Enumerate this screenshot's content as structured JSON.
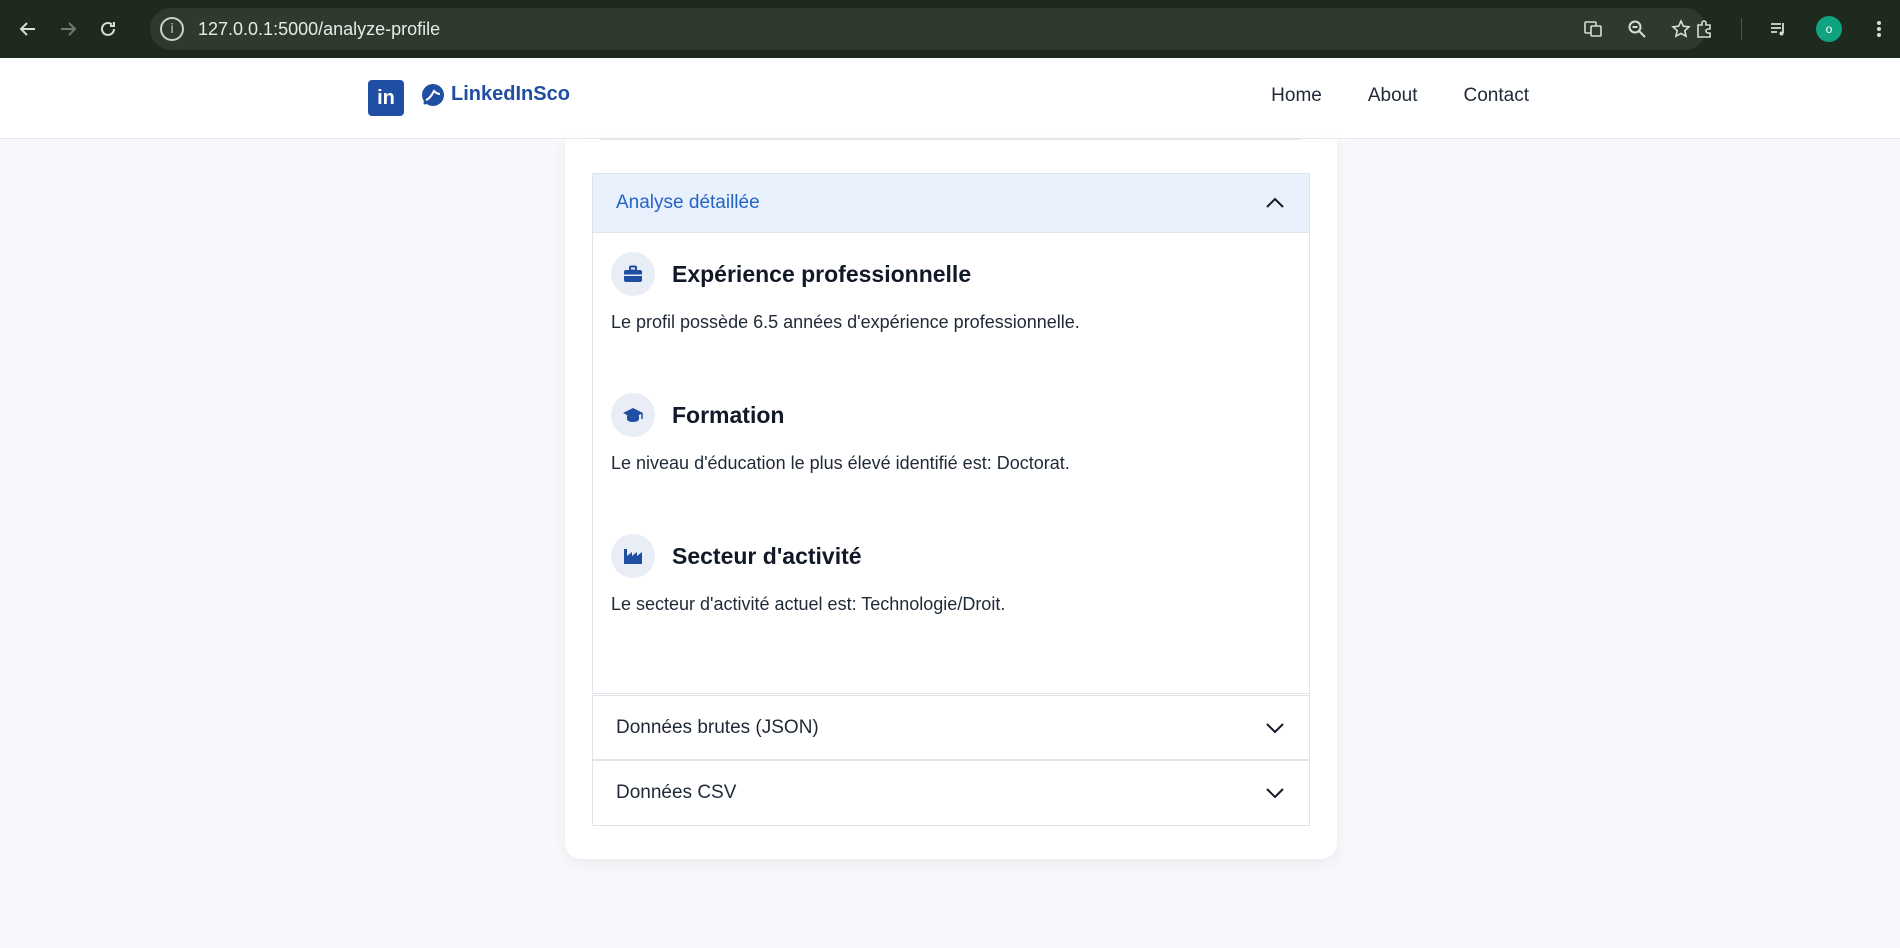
{
  "browser": {
    "url": "127.0.0.1:5000/analyze-profile",
    "avatar_letter": "o",
    "icons": [
      "back-icon",
      "forward-icon",
      "reload-icon",
      "site-info-icon",
      "translate-icon",
      "zoom-icon",
      "bookmark-star-icon",
      "extensions-icon",
      "media-icon",
      "avatar",
      "menu-icon"
    ]
  },
  "header": {
    "logo_text": "in",
    "brand": "LinkedInSco",
    "nav": [
      "Home",
      "About",
      "Contact"
    ]
  },
  "analysis": {
    "accordion_title": "Analyse détaillée",
    "sections": [
      {
        "title": "Expérience professionnelle",
        "text": "Le profil possède 6.5 années d'expérience professionnelle.",
        "icon": "briefcase-icon"
      },
      {
        "title": "Formation",
        "text": "Le niveau d'éducation le plus élevé identifié est: Doctorat.",
        "icon": "graduation-cap-icon"
      },
      {
        "title": "Secteur d'activité",
        "text": "Le secteur d'activité actuel est: Technologie/Droit.",
        "icon": "industry-icon"
      }
    ]
  },
  "accordions": {
    "json_title": "Données brutes (JSON)",
    "csv_title": "Données CSV"
  },
  "colors": {
    "accent": "#2563c9",
    "brand": "#1f4ea3",
    "open_header_bg": "#e8f0fc"
  }
}
